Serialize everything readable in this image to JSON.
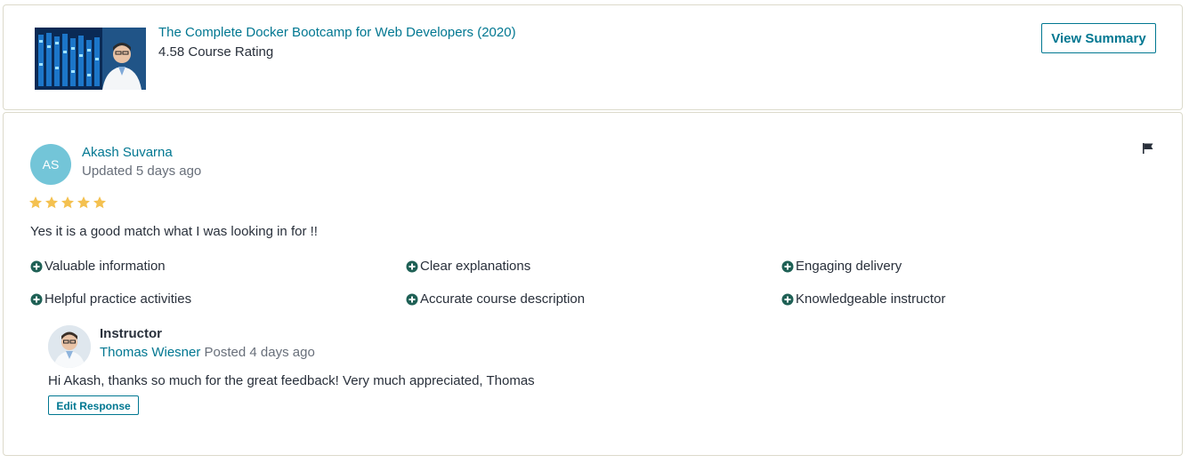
{
  "course": {
    "title": "The Complete Docker Bootcamp for Web Developers (2020)",
    "rating": "4.58 Course Rating",
    "view_summary_label": "View Summary",
    "thumbnail_icon": "course-thumbnail-server-rack"
  },
  "review": {
    "avatar_initials": "AS",
    "reviewer_name": "Akash Suvarna",
    "updated": "Updated 5 days ago",
    "stars": 5,
    "text": "Yes it is a good match what I was looking in for !!",
    "flag_icon": "flag-icon",
    "tags": [
      "Valuable information",
      "Clear explanations",
      "Engaging delivery",
      "Helpful practice activities",
      "Accurate course description",
      "Knowledgeable instructor"
    ]
  },
  "response": {
    "label": "Instructor",
    "instructor_name": "Thomas Wiesner",
    "posted": "Posted 4 days ago",
    "text": "Hi Akash, thanks so much for the great feedback! Very much appreciated, Thomas",
    "edit_label": "Edit Response"
  },
  "colors": {
    "link": "#007791",
    "star": "#f4c150",
    "tag_icon": "#1e6055",
    "avatar_bg": "#73c5d8",
    "border": "#dcdacb"
  }
}
